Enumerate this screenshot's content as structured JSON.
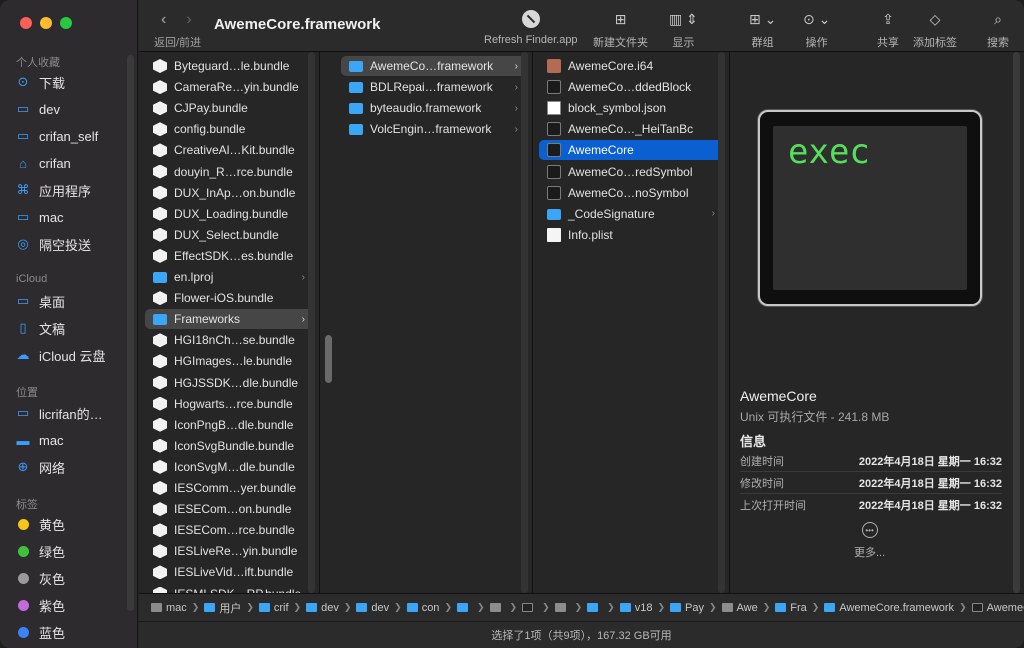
{
  "window": {
    "title": "AwemeCore.framework"
  },
  "toolbar": {
    "nav_label": "返回/前进",
    "refresh_label": "Refresh Finder.app",
    "new_folder_label": "新建文件夹",
    "view_label": "显示",
    "group_label": "群组",
    "action_label": "操作",
    "share_label": "共享",
    "tag_label": "添加标签",
    "search_label": "搜索"
  },
  "sidebar": {
    "favorites_header": "个人收藏",
    "favorites": [
      {
        "label": "下载",
        "icon": "download-icon"
      },
      {
        "label": "dev",
        "icon": "folder-icon"
      },
      {
        "label": "crifan_self",
        "icon": "folder-icon"
      },
      {
        "label": "crifan",
        "icon": "home-icon"
      },
      {
        "label": "应用程序",
        "icon": "apps-icon"
      },
      {
        "label": "mac",
        "icon": "computer-icon"
      },
      {
        "label": "隔空投送",
        "icon": "airdrop-icon"
      }
    ],
    "icloud_header": "iCloud",
    "icloud": [
      {
        "label": "桌面",
        "icon": "desktop-icon"
      },
      {
        "label": "文稿",
        "icon": "document-icon"
      },
      {
        "label": "iCloud 云盘",
        "icon": "cloud-icon"
      }
    ],
    "locations_header": "位置",
    "locations": [
      {
        "label": "licrifan的…",
        "icon": "laptop-icon"
      },
      {
        "label": "mac",
        "icon": "drive-icon"
      },
      {
        "label": "网络",
        "icon": "network-icon"
      }
    ],
    "tags_header": "标签",
    "tags": [
      {
        "label": "黄色",
        "color": "#f5c518"
      },
      {
        "label": "绿色",
        "color": "#3ec23e"
      },
      {
        "label": "灰色",
        "color": "#9a9a9a"
      },
      {
        "label": "紫色",
        "color": "#c36bdb"
      },
      {
        "label": "蓝色",
        "color": "#3b82f6"
      }
    ]
  },
  "column1": [
    {
      "label": "Byteguard…le.bundle",
      "type": "bundle"
    },
    {
      "label": "CameraRe…yin.bundle",
      "type": "bundle"
    },
    {
      "label": "CJPay.bundle",
      "type": "bundle"
    },
    {
      "label": "config.bundle",
      "type": "bundle"
    },
    {
      "label": "CreativeAl…Kit.bundle",
      "type": "bundle"
    },
    {
      "label": "douyin_R…rce.bundle",
      "type": "bundle"
    },
    {
      "label": "DUX_InAp…on.bundle",
      "type": "bundle"
    },
    {
      "label": "DUX_Loading.bundle",
      "type": "bundle"
    },
    {
      "label": "DUX_Select.bundle",
      "type": "bundle"
    },
    {
      "label": "EffectSDK…es.bundle",
      "type": "bundle"
    },
    {
      "label": "en.lproj",
      "type": "folder",
      "chevron": true
    },
    {
      "label": "Flower-iOS.bundle",
      "type": "bundle"
    },
    {
      "label": "Frameworks",
      "type": "folder",
      "chevron": true,
      "selected": true
    },
    {
      "label": "HGI18nCh…se.bundle",
      "type": "bundle"
    },
    {
      "label": "HGImages…le.bundle",
      "type": "bundle"
    },
    {
      "label": "HGJSSDK…dle.bundle",
      "type": "bundle"
    },
    {
      "label": "Hogwarts…rce.bundle",
      "type": "bundle"
    },
    {
      "label": "IconPngB…dle.bundle",
      "type": "bundle"
    },
    {
      "label": "IconSvgBundle.bundle",
      "type": "bundle"
    },
    {
      "label": "IconSvgM…dle.bundle",
      "type": "bundle"
    },
    {
      "label": "IESComm…yer.bundle",
      "type": "bundle"
    },
    {
      "label": "IESECom…on.bundle",
      "type": "bundle"
    },
    {
      "label": "IESECom…rce.bundle",
      "type": "bundle"
    },
    {
      "label": "IESLiveRe…yin.bundle",
      "type": "bundle"
    },
    {
      "label": "IESLiveVid…ift.bundle",
      "type": "bundle"
    },
    {
      "label": "IESMLSDK…RP.bundle",
      "type": "bundle"
    }
  ],
  "column2": [
    {
      "label": "AwemeCo…framework",
      "type": "folder",
      "chevron": true,
      "selected": true
    },
    {
      "label": "BDLRepai…framework",
      "type": "folder",
      "chevron": true
    },
    {
      "label": "byteaudio.framework",
      "type": "folder",
      "chevron": true
    },
    {
      "label": "VolcEngin…framework",
      "type": "folder",
      "chevron": true
    }
  ],
  "column3": [
    {
      "label": "AwemeCore.i64",
      "type": "img"
    },
    {
      "label": "AwemeCo…ddedBlock",
      "type": "exec"
    },
    {
      "label": "block_symbol.json",
      "type": "json"
    },
    {
      "label": "AwemeCo…_HeiTanBc",
      "type": "exec"
    },
    {
      "label": "AwemeCore",
      "type": "exec",
      "selected": true
    },
    {
      "label": "AwemeCo…redSymbol",
      "type": "exec"
    },
    {
      "label": "AwemeCo…noSymbol",
      "type": "exec"
    },
    {
      "label": "_CodeSignature",
      "type": "folder",
      "chevron": true
    },
    {
      "label": "Info.plist",
      "type": "doc"
    }
  ],
  "preview": {
    "icon_text": "exec",
    "name": "AwemeCore",
    "kind": "Unix 可执行文件 - 241.8 MB",
    "info_header": "信息",
    "rows": [
      {
        "k": "创建时间",
        "v": "2022年4月18日 星期一 16:32"
      },
      {
        "k": "修改时间",
        "v": "2022年4月18日 星期一 16:32"
      },
      {
        "k": "上次打开时间",
        "v": "2022年4月18日 星期一 16:32"
      }
    ],
    "more_label": "更多..."
  },
  "pathbar": [
    {
      "label": "mac",
      "icon": "drive"
    },
    {
      "label": "用户",
      "icon": "folder"
    },
    {
      "label": "crif",
      "icon": "folder"
    },
    {
      "label": "dev",
      "icon": "folder"
    },
    {
      "label": "dev",
      "icon": "folder"
    },
    {
      "label": "con",
      "icon": "folder"
    },
    {
      "label": "",
      "icon": "folder"
    },
    {
      "label": "",
      "icon": "gray"
    },
    {
      "label": "",
      "icon": "exec"
    },
    {
      "label": "",
      "icon": "gray"
    },
    {
      "label": "",
      "icon": "folder"
    },
    {
      "label": "v18",
      "icon": "folder"
    },
    {
      "label": "Pay",
      "icon": "folder"
    },
    {
      "label": "Awe",
      "icon": "gray"
    },
    {
      "label": "Fra",
      "icon": "folder"
    },
    {
      "label": "AwemeCore.framework",
      "icon": "folder"
    },
    {
      "label": "AwemeCore",
      "icon": "exec"
    }
  ],
  "status": {
    "text": "选择了1项（共9项），167.32 GB可用"
  }
}
